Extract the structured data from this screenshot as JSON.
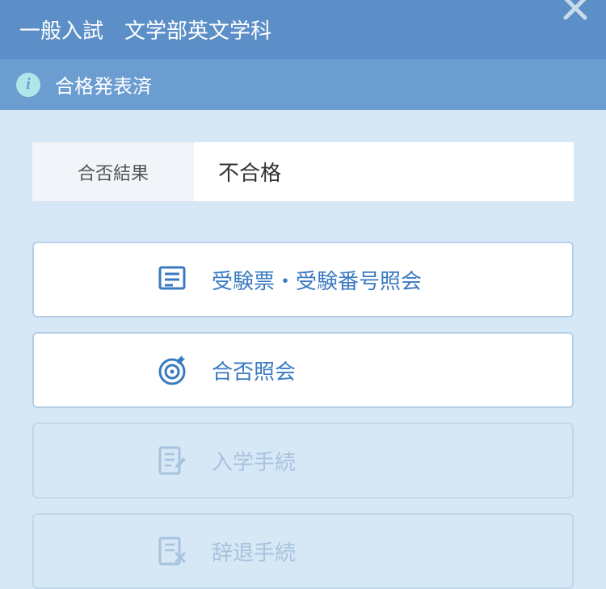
{
  "header": {
    "title": "一般入試　文学部英文学科"
  },
  "status": {
    "text": "合格発表済"
  },
  "result": {
    "label": "合否結果",
    "value": "不合格"
  },
  "menu": {
    "items": [
      {
        "label": "受験票・受験番号照会",
        "enabled": true,
        "icon": "document"
      },
      {
        "label": "合否照会",
        "enabled": true,
        "icon": "target"
      },
      {
        "label": "入学手続",
        "enabled": false,
        "icon": "edit-document"
      },
      {
        "label": "辞退手続",
        "enabled": false,
        "icon": "cancel-document"
      }
    ]
  }
}
